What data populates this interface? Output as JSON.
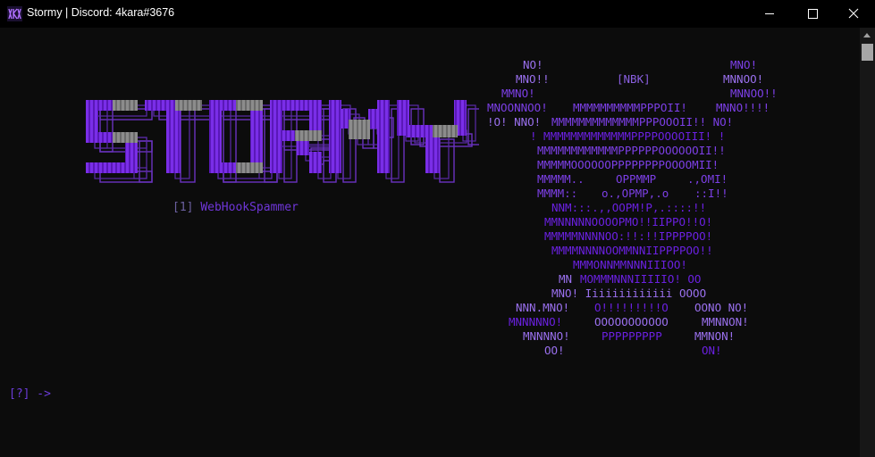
{
  "window": {
    "title": "Stormy | Discord: 4kara#3676",
    "buttons": {
      "minimize": "minimize",
      "maximize": "maximize",
      "close": "close"
    }
  },
  "logo": {
    "text": "STORMY",
    "colors": {
      "primary": "#7a2ee8",
      "grey": "#8c8c8c",
      "outline": "#6a32c0"
    }
  },
  "menu": {
    "options": [
      {
        "key": "[1]",
        "label": "WebHookSpammer"
      }
    ]
  },
  "ascii_art": {
    "lines": [
      {
        "segments": [
          {
            "text": "NO!",
            "tone": "light"
          },
          {
            "text": "MNO!",
            "tone": "mid"
          }
        ]
      },
      {
        "segments": [
          {
            "text": "MNO!!",
            "tone": "light"
          },
          {
            "text": "[NBK]",
            "tone": "sub"
          },
          {
            "text": "MNNOO!",
            "tone": "light"
          }
        ]
      },
      {
        "segments": [
          {
            "text": "MMNO!",
            "tone": "mid"
          },
          {
            "text": "MNNOO!!",
            "tone": "mid"
          }
        ]
      },
      {
        "segments": [
          {
            "text": "MNOONNOO!",
            "tone": "mid"
          },
          {
            "text": "MMMMMMMMMMPPPOII!",
            "tone": "mid"
          },
          {
            "text": "MNNO!!!!",
            "tone": "mid"
          }
        ]
      },
      {
        "segments": [
          {
            "text": "!O! NNO!",
            "tone": "light"
          },
          {
            "text": "MMMMMMMMMMMMMPPPOOOII!! NO!",
            "tone": "mid"
          }
        ]
      },
      {
        "segments": [
          {
            "text": "! MMMMMMMMMMMMMPPPPOOOOIII! !",
            "tone": "deep"
          }
        ]
      },
      {
        "segments": [
          {
            "text": "MMMMMMMMMMMMPPPPPPOOOOOOII!!",
            "tone": "mid"
          }
        ]
      },
      {
        "segments": [
          {
            "text": "MMMMMOOOOOOPPPPPPPPOOOOMII!",
            "tone": "mid"
          }
        ]
      },
      {
        "segments": [
          {
            "text": "MMMMM..",
            "tone": "mid"
          },
          {
            "text": "OPPMMP",
            "tone": "mid"
          },
          {
            "text": ".,OMI!",
            "tone": "mid"
          }
        ]
      },
      {
        "segments": [
          {
            "text": "MMMM::",
            "tone": "mid"
          },
          {
            "text": "o.,OPMP,.o",
            "tone": "mid"
          },
          {
            "text": "::I!!",
            "tone": "mid"
          }
        ]
      },
      {
        "segments": [
          {
            "text": "NNM:::.,,OOPM!P,.::::!!",
            "tone": "deep"
          }
        ]
      },
      {
        "segments": [
          {
            "text": "MMNNNNNOOOOPMO!!IIPPO!!O!",
            "tone": "deep"
          }
        ]
      },
      {
        "segments": [
          {
            "text": "MMMMMNNNNOO:!!:!!IPPPPOO!",
            "tone": "deep"
          }
        ]
      },
      {
        "segments": [
          {
            "text": "MMMMNNNNOOMMNNIIPPPPOO!!",
            "tone": "deep"
          }
        ]
      },
      {
        "segments": [
          {
            "text": "MMMONNMMNNNIIIOO!",
            "tone": "deep"
          }
        ]
      },
      {
        "segments": [
          {
            "text": "MN",
            "tone": "light"
          },
          {
            "text": "MOMMMNNNIIIIIO! OO",
            "tone": "deep"
          }
        ]
      },
      {
        "segments": [
          {
            "text": "MNO! Iiiiiiiiiiiii OOOO",
            "tone": "light"
          }
        ]
      },
      {
        "segments": [
          {
            "text": "NNN.MNO!",
            "tone": "light"
          },
          {
            "text": "O!!!!!!!!!O",
            "tone": "deep"
          },
          {
            "text": "OONO NO!",
            "tone": "light"
          }
        ]
      },
      {
        "segments": [
          {
            "text": "MNNNNNO!",
            "tone": "deep"
          },
          {
            "text": "OOOOOOOOOOO",
            "tone": "light"
          },
          {
            "text": "MMNNON!",
            "tone": "light"
          }
        ]
      },
      {
        "segments": [
          {
            "text": "MNNNNO!",
            "tone": "light"
          },
          {
            "text": "PPPPPPPPP",
            "tone": "deep"
          },
          {
            "text": "MMNON!",
            "tone": "light"
          }
        ]
      },
      {
        "segments": [
          {
            "text": "OO!",
            "tone": "light"
          },
          {
            "text": "ON!",
            "tone": "deep"
          }
        ]
      }
    ]
  },
  "prompt": {
    "text": "[?] ->"
  }
}
